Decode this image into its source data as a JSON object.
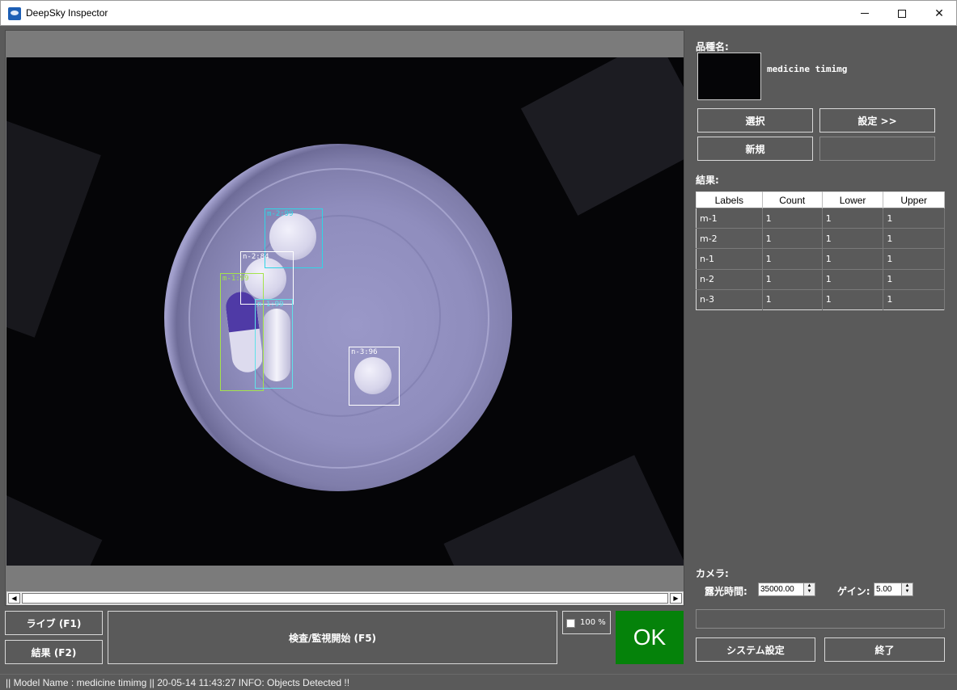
{
  "window": {
    "title": "DeepSky Inspector",
    "minimize_glyph": "",
    "maximize_glyph": "",
    "close_glyph": "✕"
  },
  "viewer": {
    "detections": [
      {
        "label": "m-2:99",
        "color": "#2fd6e6"
      },
      {
        "label": "n-2:84",
        "color": "#ffffff"
      },
      {
        "label": "m-1:99",
        "color": "#a4e34c"
      },
      {
        "label": "n-1:99",
        "color": "#5fe3ea"
      },
      {
        "label": "n-3:96",
        "color": "#ffffff"
      }
    ],
    "scroll_left_glyph": "◀",
    "scroll_right_glyph": "▶"
  },
  "controls": {
    "live_label": "ライブ (F1)",
    "result_label": "結果 (F2)",
    "start_label": "検査/監視開始 (F5)",
    "zoom_label": "100 %",
    "zoom_checked": false,
    "judgement": "OK",
    "judgement_color": "#05820a"
  },
  "product": {
    "section_label": "品種名:",
    "name": "medicine timimg",
    "select_label": "選択",
    "settings_label": "設定 >>",
    "new_label": "新規"
  },
  "results": {
    "section_label": "結果:",
    "columns": [
      "Labels",
      "Count",
      "Lower",
      "Upper"
    ],
    "rows": [
      [
        "m-1",
        "1",
        "1",
        "1"
      ],
      [
        "m-2",
        "1",
        "1",
        "1"
      ],
      [
        "n-1",
        "1",
        "1",
        "1"
      ],
      [
        "n-2",
        "1",
        "1",
        "1"
      ],
      [
        "n-3",
        "1",
        "1",
        "1"
      ]
    ]
  },
  "camera": {
    "section_label": "カメラ:",
    "exposure_label": "露光時間:",
    "exposure_value": "35000.00",
    "gain_label": "ゲイン:",
    "gain_value": "5.00",
    "spin_up_glyph": "▲",
    "spin_down_glyph": "▼"
  },
  "footer": {
    "system_settings_label": "システム設定",
    "exit_label": "終了"
  },
  "status": {
    "text": "|| Model Name : medicine timimg ||    20-05-14 11:43:27   INFO:   Objects Detected !!"
  }
}
